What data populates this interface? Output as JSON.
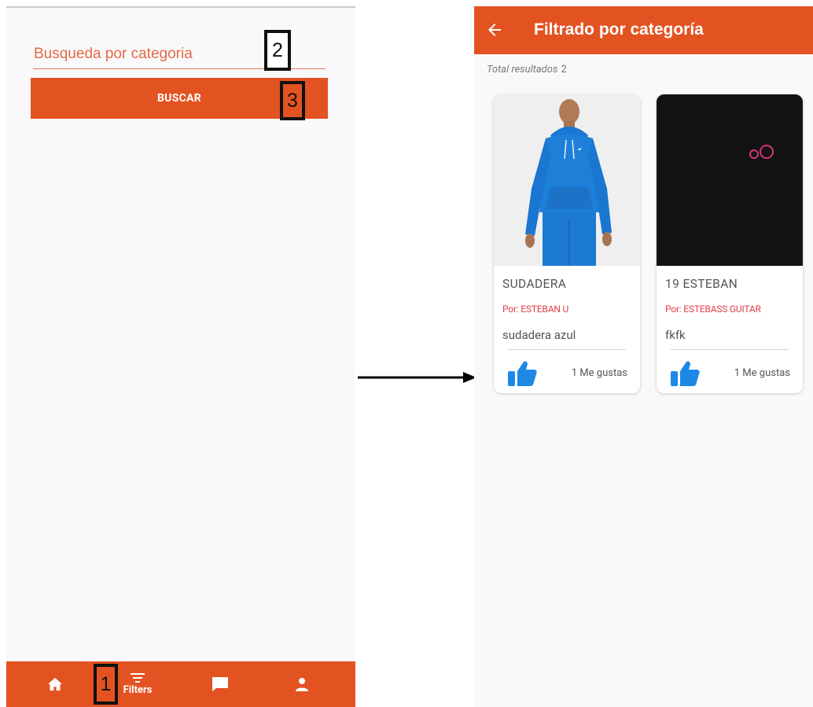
{
  "left_screen": {
    "search": {
      "placeholder": "Busqueda por categoria"
    },
    "buscar_label": "BUSCAR",
    "steps": {
      "one": "1",
      "two": "2",
      "three": "3"
    },
    "bottom_nav": {
      "items": [
        {
          "icon": "home-icon",
          "label": ""
        },
        {
          "icon": "filter-icon",
          "label": "Filters"
        },
        {
          "icon": "chat-icon",
          "label": ""
        },
        {
          "icon": "person-icon",
          "label": ""
        }
      ]
    }
  },
  "right_screen": {
    "title": "Filtrado por categoría",
    "total_label": "Total resultados",
    "total_count": "2",
    "cards": [
      {
        "title": "SUDADERA",
        "author": "Por: ESTEBAN U",
        "description": "sudadera azul",
        "likes": "1 Me gustas",
        "image": "blue-hoodie-person"
      },
      {
        "title": "19 ESTEBAN",
        "author": "Por: ESTEBASS GUITAR",
        "description": "fkfk",
        "likes": "1 Me gustas",
        "image": "dark-image-pink-circles"
      }
    ]
  },
  "colors": {
    "accent": "#e35322",
    "author_red": "#e0404a",
    "like_blue": "#1e88e5",
    "hoodie_blue": "#1e7fd8"
  }
}
